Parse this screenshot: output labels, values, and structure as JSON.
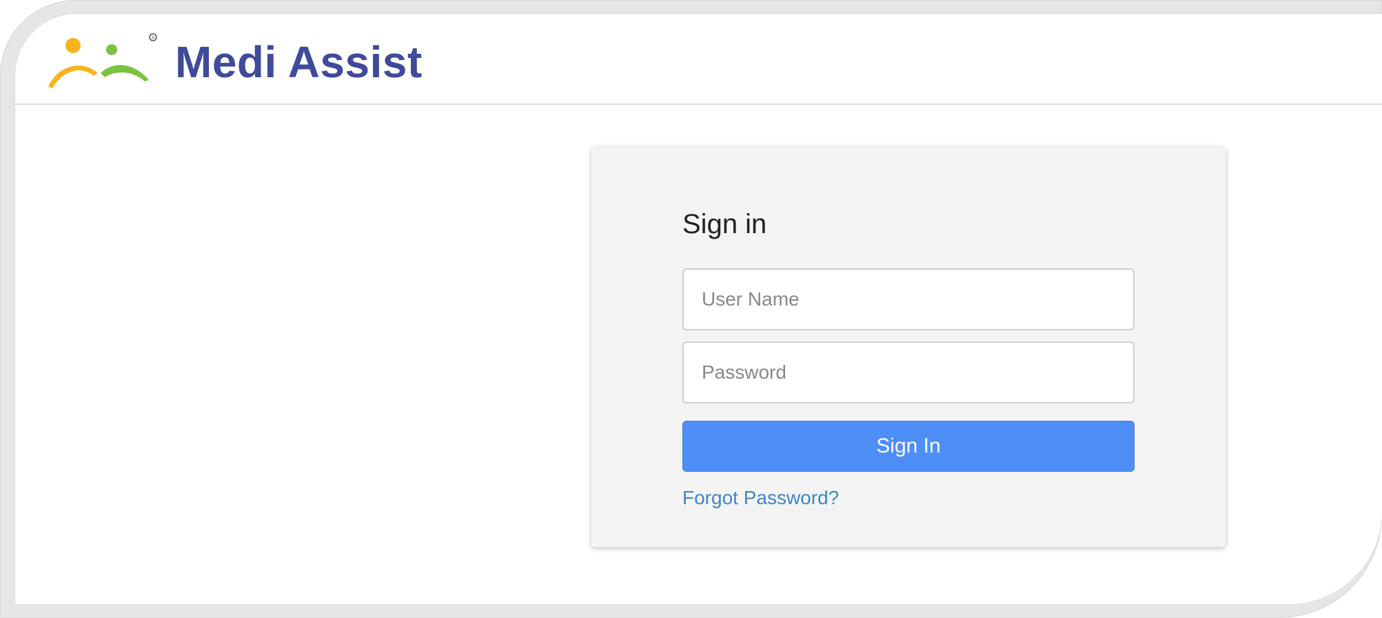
{
  "brand": {
    "name": "Medi Assist",
    "registered_mark": "®",
    "colors": {
      "text": "#3f4a9a",
      "figure_left": "#f7b31b",
      "figure_right": "#7cc242"
    }
  },
  "signin": {
    "title": "Sign in",
    "username_placeholder": "User Name",
    "password_placeholder": "Password",
    "submit_label": "Sign In",
    "forgot_label": "Forgot Password?"
  },
  "colors": {
    "button": "#4e8ef7",
    "link": "#3f85c8",
    "card_bg": "#f4f4f4"
  }
}
